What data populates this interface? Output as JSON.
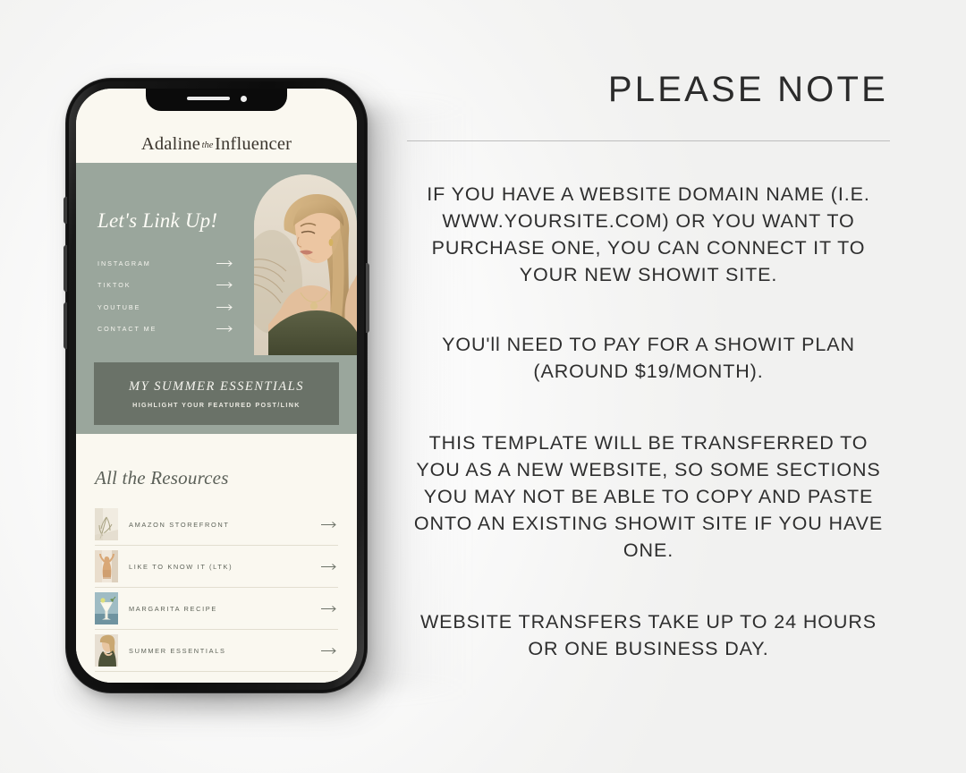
{
  "phone": {
    "brand": {
      "name_part1": "Adaline",
      "name_the": "the",
      "name_part2": "Influencer"
    },
    "notch": {
      "speaker": "speaker-slot",
      "camera": "front-camera"
    },
    "hero": {
      "title": "Let's Link Up!",
      "links": [
        {
          "label": "INSTAGRAM",
          "icon": "arrow-right-icon"
        },
        {
          "label": "TIKTOK",
          "icon": "arrow-right-icon"
        },
        {
          "label": "YOUTUBE",
          "icon": "arrow-right-icon"
        },
        {
          "label": "CONTACT ME",
          "icon": "arrow-right-icon"
        }
      ],
      "photo_alt": "portrait-photo-blonde-woman"
    },
    "featured": {
      "title": "MY SUMMER ESSENTIALS",
      "subtitle": "HIGHLIGHT YOUR FEATURED POST/LINK"
    },
    "resources": {
      "heading": "All the Resources",
      "items": [
        {
          "label": "AMAZON STOREFRONT",
          "thumb": "thumb-pampas-grass",
          "icon": "arrow-right-icon"
        },
        {
          "label": "LIKE TO KNOW IT (LTK)",
          "thumb": "thumb-woman-curtain",
          "icon": "arrow-right-icon"
        },
        {
          "label": "MARGARITA RECIPE",
          "thumb": "thumb-cocktail-glass",
          "icon": "arrow-right-icon"
        },
        {
          "label": "SUMMER ESSENTIALS",
          "thumb": "thumb-woman-portrait",
          "icon": "arrow-right-icon"
        }
      ]
    }
  },
  "note": {
    "heading": "PLEASE NOTE",
    "paragraphs": [
      "IF YOU HAVE A WEBSITE DOMAIN NAME (I.E. WWW.YOURSITE.COM) OR YOU WANT TO PURCHASE ONE, YOU CAN CONNECT IT TO YOUR NEW SHOWIT SITE.",
      "YOU'll NEED TO PAY FOR A SHOWIT PLAN (AROUND $19/MONTH).",
      "THIS TEMPLATE WILL BE TRANSFERRED TO YOU AS A NEW WEBSITE, SO SOME SECTIONS YOU MAY NOT BE ABLE TO COPY AND PASTE ONTO AN EXISTING SHOWIT SITE IF YOU HAVE ONE.",
      "WEBSITE TRANSFERS TAKE UP TO 24 HOURS OR ONE BUSINESS DAY."
    ]
  },
  "colors": {
    "page_background": "#f6f6f5",
    "sage_green": "#9aa69c",
    "dark_green": "#6a7268",
    "cream": "#faf8f0",
    "phone_body": "#111111",
    "text_dark": "#2e2e2e",
    "text_sage": "#5e6359"
  }
}
